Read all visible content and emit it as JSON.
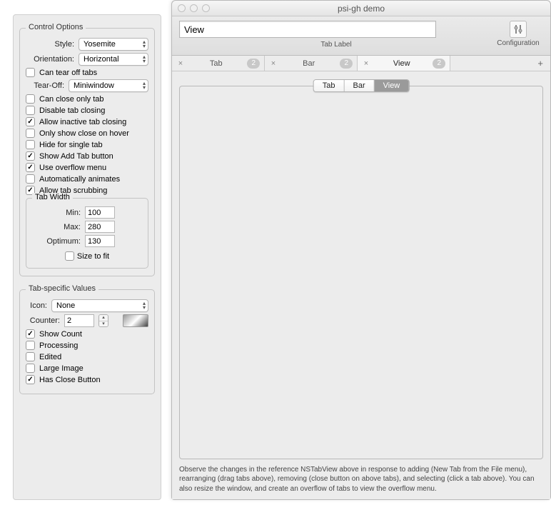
{
  "left": {
    "control_title": "Control Options",
    "style_label": "Style:",
    "style_value": "Yosemite",
    "orientation_label": "Orientation:",
    "orientation_value": "Horizontal",
    "tearoff_chk": "Can tear off tabs",
    "tearoff_label": "Tear-Off:",
    "tearoff_value": "Miniwindow",
    "close_only": "Can close only tab",
    "disable_close": "Disable tab closing",
    "allow_inactive": "Allow inactive tab closing",
    "hover_close": "Only show close on hover",
    "hide_single": "Hide for single tab",
    "show_add": "Show Add Tab button",
    "overflow": "Use overflow menu",
    "auto_anim": "Automatically animates",
    "scrub": "Allow tab scrubbing",
    "tabwidth_title": "Tab Width",
    "min_label": "Min:",
    "min_val": "100",
    "max_label": "Max:",
    "max_val": "280",
    "opt_label": "Optimum:",
    "opt_val": "130",
    "size_fit": "Size to fit",
    "tabspec_title": "Tab-specific Values",
    "icon_label": "Icon:",
    "icon_value": "None",
    "counter_label": "Counter:",
    "counter_val": "2",
    "show_count": "Show Count",
    "processing": "Processing",
    "edited": "Edited",
    "large_image": "Large Image",
    "has_close": "Has Close Button"
  },
  "win": {
    "title": "psi-gh demo",
    "tab_label_value": "View",
    "tab_label_caption": "Tab Label",
    "config_caption": "Configuration",
    "tabs": [
      {
        "title": "Tab",
        "badge": "2"
      },
      {
        "title": "Bar",
        "badge": "2"
      },
      {
        "title": "View",
        "badge": "2"
      }
    ],
    "add_glyph": "+",
    "segs": [
      "Tab",
      "Bar",
      "View"
    ],
    "footer": "Observe the changes in the reference NSTabView above in response to adding (New Tab from the File menu), rearranging (drag tabs above), removing (close button on above tabs), and selecting (click a tab above).  You can also resize the window, and create an overflow of tabs to view the overflow menu."
  }
}
